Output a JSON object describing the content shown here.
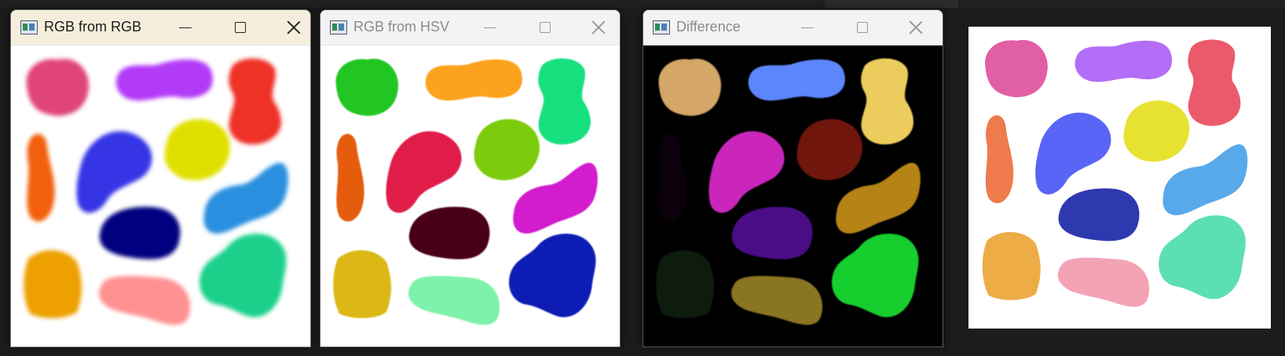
{
  "windows": [
    {
      "title": "RGB from RGB",
      "active": true,
      "background": "#ffffff",
      "blur": 2.6,
      "blobs": [
        {
          "shape": "round",
          "color": "#e0457a"
        },
        {
          "shape": "pill",
          "color": "#b23af8"
        },
        {
          "shape": "peanut",
          "color": "#ee3028"
        },
        {
          "shape": "thin",
          "color": "#f2600f"
        },
        {
          "shape": "hand",
          "color": "#3535e6"
        },
        {
          "shape": "round",
          "color": "#e0e000"
        },
        {
          "shape": "kidney",
          "color": "#2a8fde"
        },
        {
          "shape": "bean",
          "color": "#000080"
        },
        {
          "shape": "squircle",
          "color": "#eea006"
        },
        {
          "shape": "sausage",
          "color": "#ff9191"
        },
        {
          "shape": "bigblob",
          "color": "#1ed08c"
        }
      ]
    },
    {
      "title": "RGB from HSV",
      "active": false,
      "background": "#ffffff",
      "blur": 0.9,
      "blobs": [
        {
          "shape": "round",
          "color": "#22c622"
        },
        {
          "shape": "pill",
          "color": "#fca21a"
        },
        {
          "shape": "peanut",
          "color": "#16e07e"
        },
        {
          "shape": "thin",
          "color": "#e65c0c"
        },
        {
          "shape": "hand",
          "color": "#e01a4a"
        },
        {
          "shape": "round",
          "color": "#7ccc10"
        },
        {
          "shape": "kidney",
          "color": "#d21ace"
        },
        {
          "shape": "bean",
          "color": "#480014"
        },
        {
          "shape": "squircle",
          "color": "#dcb812"
        },
        {
          "shape": "sausage",
          "color": "#7ef2aa"
        },
        {
          "shape": "bigblob",
          "color": "#0c1eb4"
        }
      ]
    },
    {
      "title": "Difference",
      "active": false,
      "background": "#000000",
      "blur": 0.9,
      "blobs": [
        {
          "shape": "round",
          "color": "#d4a668"
        },
        {
          "shape": "pill",
          "color": "#5c86fc"
        },
        {
          "shape": "peanut",
          "color": "#eccc5c"
        },
        {
          "shape": "thin",
          "color": "#0c0610"
        },
        {
          "shape": "hand",
          "color": "#ca28bc"
        },
        {
          "shape": "round",
          "color": "#701610"
        },
        {
          "shape": "kidney",
          "color": "#b68412"
        },
        {
          "shape": "bean",
          "color": "#4c0a86"
        },
        {
          "shape": "squircle",
          "color": "#0e1a0e"
        },
        {
          "shape": "sausage",
          "color": "#8a7424"
        },
        {
          "shape": "bigblob",
          "color": "#14ce2e"
        }
      ]
    }
  ],
  "side_panel": {
    "background": "#ffffff",
    "blobs": [
      {
        "shape": "round",
        "color": "#e15fa6"
      },
      {
        "shape": "pill",
        "color": "#b46df6"
      },
      {
        "shape": "peanut",
        "color": "#eb5a6b"
      },
      {
        "shape": "thin",
        "color": "#ef7a4b"
      },
      {
        "shape": "hand",
        "color": "#5965f6"
      },
      {
        "shape": "round",
        "color": "#e7e231"
      },
      {
        "shape": "kidney",
        "color": "#58a9ea"
      },
      {
        "shape": "bean",
        "color": "#2e39b0"
      },
      {
        "shape": "squircle",
        "color": "#edac45"
      },
      {
        "shape": "sausage",
        "color": "#f3a3b4"
      },
      {
        "shape": "bigblob",
        "color": "#5cdfb4"
      }
    ]
  },
  "icons": {
    "app": "opencv-window-icon",
    "minimize": "minimize-icon",
    "maximize": "maximize-icon",
    "close": "close-icon"
  }
}
